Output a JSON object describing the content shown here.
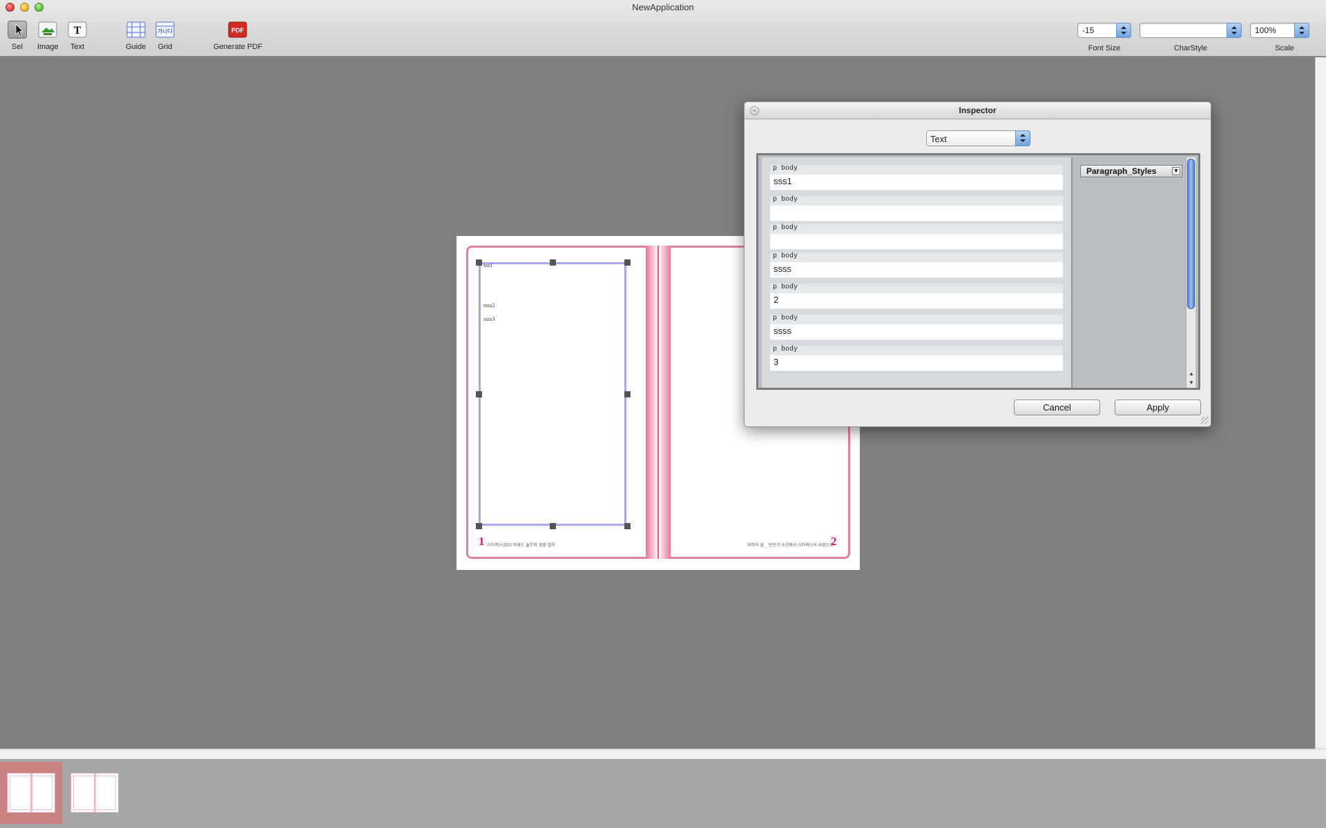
{
  "window": {
    "title": "NewApplication"
  },
  "toolbar": {
    "tools": {
      "sel": "Sel",
      "image": "Image",
      "text": "Text",
      "text_glyph": "T",
      "guide": "Guide",
      "grid": "Grid",
      "grid_glyph": "가나다",
      "generate_pdf": "Generate PDF",
      "pdf_glyph": "PDF"
    },
    "font_size": {
      "value": "-15",
      "label": "Font Size"
    },
    "char_style": {
      "value": "",
      "label": "CharStyle"
    },
    "scale": {
      "value": "100%",
      "label": "Scale"
    }
  },
  "document": {
    "left_page": {
      "frame_lines": [
        "sss1",
        "ssss2",
        "ssss3"
      ],
      "page_number": "1",
      "folio": "스티백스(SIO 하워드 슐츠의 경영 철학"
    },
    "right_page": {
      "page_number": "2",
      "folio": "커피의 꿈 _ 빈민가 소년에서 스타벅스의 사장으로"
    }
  },
  "inspector": {
    "title": "Inspector",
    "type_select": "Text",
    "paragraph_style_combo": "Paragraph_Styles",
    "paragraphs": [
      {
        "tag": "p  body",
        "text": "sss1"
      },
      {
        "tag": "p  body",
        "text": ""
      },
      {
        "tag": "p  body",
        "text": ""
      },
      {
        "tag": "p  body",
        "text": "ssss"
      },
      {
        "tag": "p  body",
        "text": "2"
      },
      {
        "tag": "p  body",
        "text": "ssss"
      },
      {
        "tag": "p  body",
        "text": "3"
      }
    ],
    "buttons": {
      "cancel": "Cancel",
      "apply": "Apply"
    }
  },
  "thumbnails": {
    "count": 2,
    "selected_index": 0
  },
  "colors": {
    "page_border": "#e37fa5",
    "page_number": "#d01a75",
    "text_frame": "#a9a9f2",
    "canvas_bg": "#7f7f7f",
    "selected_thumb": "#c98080"
  }
}
